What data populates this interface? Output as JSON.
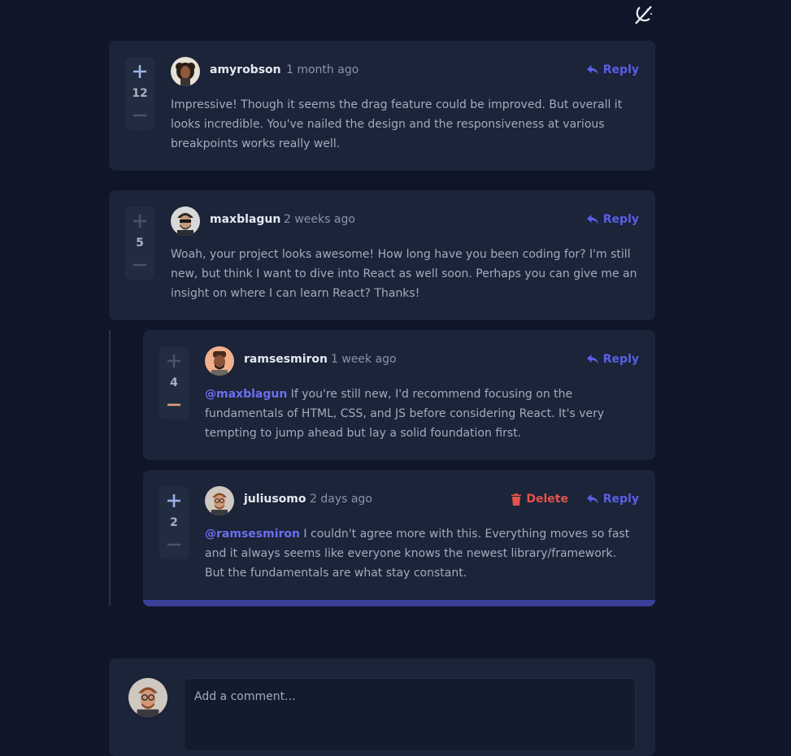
{
  "theme_toggle_icon": "moon-slash-icon",
  "comments": [
    {
      "username": "amyrobson",
      "time": "1 month ago",
      "score": "12",
      "reply_label": "Reply",
      "text": "Impressive! Though it seems the drag feature could be improved. But overall it looks incredible. You've nailed the design and the responsiveness at various breakpoints works really well."
    },
    {
      "username": "maxblagun",
      "time": "2 weeks ago",
      "score": "5",
      "reply_label": "Reply",
      "text": "Woah, your project looks awesome! How long have you been coding for? I'm still new, but think I want to dive into React as well soon. Perhaps you can give me an insight on where I can learn React? Thanks!"
    }
  ],
  "replies": [
    {
      "username": "ramsesmiron",
      "time": "1 week ago",
      "score": "4",
      "reply_label": "Reply",
      "mention": "@maxblagun",
      "text": " If you're still new, I'd recommend focusing on the fundamentals of HTML, CSS, and JS before considering React. It's very tempting to jump ahead but lay a solid foundation first."
    },
    {
      "username": "juliusomo",
      "time": "2 days ago",
      "score": "2",
      "reply_label": "Reply",
      "delete_label": "Delete",
      "mention": "@ramsesmiron",
      "text": " I couldn't agree more with this. Everything moves so fast and it always seems like everyone knows the newest library/framework. But the fundamentals are what stay constant."
    }
  ],
  "compose": {
    "placeholder": "Add a comment..."
  },
  "colors": {
    "accent": "#5a5fe6",
    "danger": "#e5534b",
    "card": "#1b2438",
    "background": "#0f1629"
  }
}
